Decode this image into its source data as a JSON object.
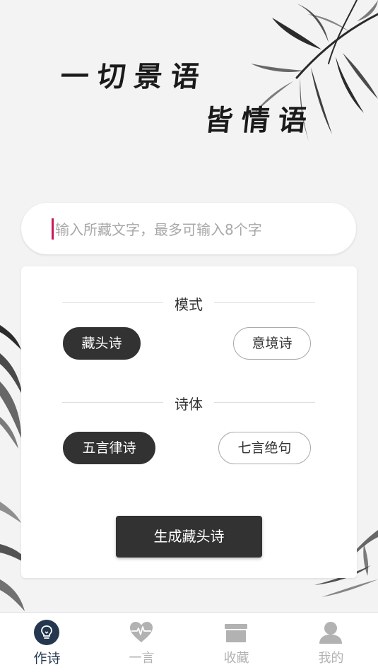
{
  "hero": {
    "line1": "一切景语",
    "line2": "皆情语"
  },
  "search": {
    "value": "",
    "placeholder": "输入所藏文字，最多可输入8个字"
  },
  "mode": {
    "label": "模式",
    "options": [
      {
        "label": "藏头诗",
        "selected": true
      },
      {
        "label": "意境诗",
        "selected": false
      }
    ]
  },
  "style": {
    "label": "诗体",
    "options": [
      {
        "label": "五言律诗",
        "selected": true
      },
      {
        "label": "七言绝句",
        "selected": false
      }
    ]
  },
  "generate_label": "生成藏头诗",
  "tabs": [
    {
      "label": "作诗",
      "icon": "lightbulb-icon",
      "active": true
    },
    {
      "label": "一言",
      "icon": "heartbeat-icon",
      "active": false
    },
    {
      "label": "收藏",
      "icon": "archive-box-icon",
      "active": false
    },
    {
      "label": "我的",
      "icon": "user-icon",
      "active": false
    }
  ],
  "colors": {
    "accent": "#24374f",
    "cursor": "#c8185a",
    "dark_button": "#323232"
  }
}
